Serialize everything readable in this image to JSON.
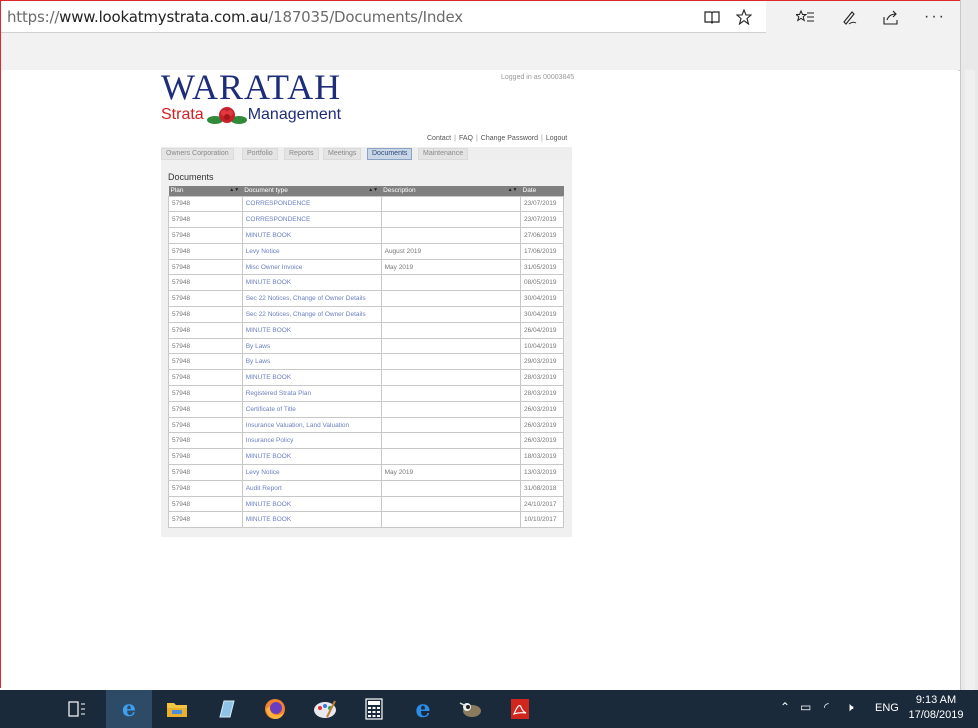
{
  "browser": {
    "url_protocol": "https://",
    "url_host": "www.lookatmystrata.com.au",
    "url_path": "/187035/Documents/Index"
  },
  "site": {
    "logo_title": "WARATAH",
    "logo_strata": "Strata",
    "logo_management": "Management",
    "logged_in": "Logged in as 00003845",
    "top_links": [
      "Contact",
      "FAQ",
      "Change Password",
      "Logout"
    ],
    "tabs": [
      "Owners Corporation",
      "Portfolio",
      "Reports",
      "Meetings",
      "Documents",
      "Maintenance"
    ],
    "active_tab": "Documents"
  },
  "documents": {
    "title": "Documents",
    "columns": [
      "Plan",
      "Document type",
      "Description",
      "Date"
    ],
    "rows": [
      {
        "plan": "57948",
        "type": "CORRESPONDENCE",
        "description": "",
        "date": "23/07/2019"
      },
      {
        "plan": "57948",
        "type": "CORRESPONDENCE",
        "description": "",
        "date": "23/07/2019"
      },
      {
        "plan": "57948",
        "type": "MINUTE BOOK",
        "description": "",
        "date": "27/06/2019"
      },
      {
        "plan": "57948",
        "type": "Levy Notice",
        "description": "August 2019",
        "date": "17/06/2019"
      },
      {
        "plan": "57948",
        "type": "Misc Owner Invoice",
        "description": "May 2019",
        "date": "31/05/2019"
      },
      {
        "plan": "57948",
        "type": "MINUTE BOOK",
        "description": "",
        "date": "08/05/2019"
      },
      {
        "plan": "57948",
        "type": "Sec 22 Notices, Change of Owner Details",
        "description": "",
        "date": "30/04/2019"
      },
      {
        "plan": "57948",
        "type": "Sec 22 Notices, Change of Owner Details",
        "description": "",
        "date": "30/04/2019"
      },
      {
        "plan": "57948",
        "type": "MINUTE BOOK",
        "description": "",
        "date": "26/04/2019"
      },
      {
        "plan": "57948",
        "type": "By Laws",
        "description": "",
        "date": "10/04/2019"
      },
      {
        "plan": "57948",
        "type": "By Laws",
        "description": "",
        "date": "29/03/2019"
      },
      {
        "plan": "57948",
        "type": "MINUTE BOOK",
        "description": "",
        "date": "28/03/2019"
      },
      {
        "plan": "57948",
        "type": "Registered Strata Plan",
        "description": "",
        "date": "28/03/2019"
      },
      {
        "plan": "57948",
        "type": "Certificate of Title",
        "description": "",
        "date": "26/03/2019"
      },
      {
        "plan": "57948",
        "type": "Insurance Valuation, Land Valuation",
        "description": "",
        "date": "26/03/2019"
      },
      {
        "plan": "57948",
        "type": "Insurance Policy",
        "description": "",
        "date": "26/03/2019"
      },
      {
        "plan": "57948",
        "type": "MINUTE BOOK",
        "description": "",
        "date": "18/03/2019"
      },
      {
        "plan": "57948",
        "type": "Levy Notice",
        "description": "May 2019",
        "date": "13/03/2019"
      },
      {
        "plan": "57948",
        "type": "Audit Report",
        "description": "",
        "date": "31/08/2018"
      },
      {
        "plan": "57948",
        "type": "MINUTE BOOK",
        "description": "",
        "date": "24/10/2017"
      },
      {
        "plan": "57948",
        "type": "MINUTE BOOK",
        "description": "",
        "date": "10/10/2017"
      }
    ]
  },
  "taskbar": {
    "apps": [
      "task-view-icon",
      "edge-icon",
      "file-explorer-icon",
      "notepad-icon",
      "firefox-icon",
      "paint-icon",
      "calculator-icon",
      "internet-explorer-icon",
      "gimp-icon",
      "acrobat-icon"
    ],
    "language": "ENG",
    "time": "9:13 AM",
    "date": "17/08/2019"
  },
  "colors": {
    "logo_blue": "#1e2d7a",
    "logo_red": "#d02020",
    "link_blue": "#6a7fc0",
    "taskbar_bg": "#1b2a3a"
  }
}
